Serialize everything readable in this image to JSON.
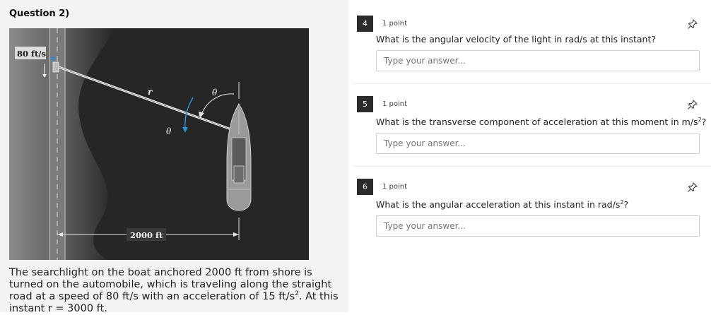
{
  "question": {
    "title": "Question 2)",
    "problem_text_1": "The searchlight on the boat anchored 2000 ft from shore is turned on the automobile, which is traveling along the straight road at a speed of 80 ft/s with an acceleration of 15 ft/s",
    "problem_sup": "2",
    "problem_text_2": ". At this instant r = 3000 ft."
  },
  "figure": {
    "speed_label": "80 ft/s",
    "r_label": "r",
    "theta_label_top": "θ",
    "theta_label_bottom": "θ",
    "distance_label": "2000 ft",
    "colors": {
      "water": "#262626",
      "shore": "#6e6e6e",
      "arrow": "#2a8fd6",
      "beam": "#ffffff"
    }
  },
  "answers": [
    {
      "number": "4",
      "points": "1 point",
      "text": "What is the angular velocity of the light in rad/s at this instant?",
      "sup": "",
      "text_after": "",
      "placeholder": "Type your answer...",
      "value": "",
      "icon": "pin-icon"
    },
    {
      "number": "5",
      "points": "1 point",
      "text": "What is the transverse component of acceleration at this moment in m/s",
      "sup": "2",
      "text_after": "?",
      "placeholder": "Type your answer...",
      "value": "",
      "icon": "pin-icon"
    },
    {
      "number": "6",
      "points": "1 point",
      "text": "What is the angular acceleration at this instant in rad/s",
      "sup": "2",
      "text_after": "?",
      "placeholder": "Type your answer...",
      "value": "",
      "icon": "pin-icon"
    }
  ]
}
